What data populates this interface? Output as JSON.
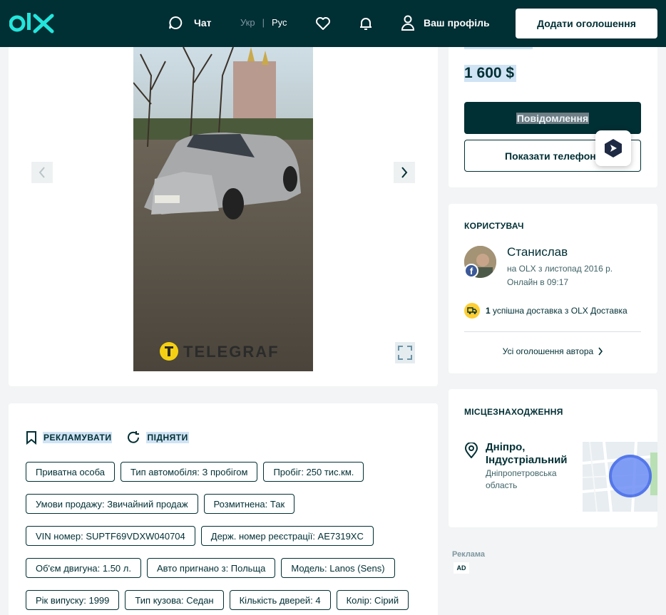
{
  "header": {
    "logo_text": "olx",
    "chat_label": "Чат",
    "lang_ukr": "Укр",
    "lang_sep": "|",
    "lang_rus": "Рус",
    "profile_label": "Ваш профіль",
    "add_button": "Додати оголошення"
  },
  "gallery": {
    "watermark": "TELEGRAF"
  },
  "actions": {
    "promote": "РЕКЛАМУВАТИ",
    "raise": "ПІДНЯТИ"
  },
  "tags": [
    [
      "Приватна особа",
      "Тип автомобіля: З пробігом",
      "Пробіг: 250 тис.км."
    ],
    [
      "Умови продажу: Звичайний продаж",
      "Розмитнена: Так"
    ],
    [
      "VIN номер: SUPTF69VDXW040704",
      "Держ. номер реєстрації: AE7319XC"
    ],
    [
      "Об'єм двигуна: 1.50 л.",
      "Авто пригнано з: Польща",
      "Модель: Lanos (Sens)"
    ],
    [
      "Рік випуску: 1999",
      "Тип кузова: Седан",
      "Кількість дверей: 4",
      "Колір: Сірий"
    ]
  ],
  "price": {
    "amount": "1 600 $",
    "message_button": "Повідомлення",
    "phone_button": "Показати телефон"
  },
  "user": {
    "section_title": "КОРИСТУВАЧ",
    "name": "Станислав",
    "since": "на OLX з листопад 2016 р.",
    "online": "Онлайн в 09:17",
    "delivery_count": "1",
    "delivery_text": "успішна доставка з OLX Доставка",
    "all_ads": "Усі оголошення автора",
    "fb_badge": "f"
  },
  "location": {
    "section_title": "МІСЦЕЗНАХОДЖЕННЯ",
    "city": "Дніпро, Індустріальний",
    "region": "Дніпропетровська область"
  },
  "ad": {
    "label": "Реклама",
    "badge": "AD"
  }
}
